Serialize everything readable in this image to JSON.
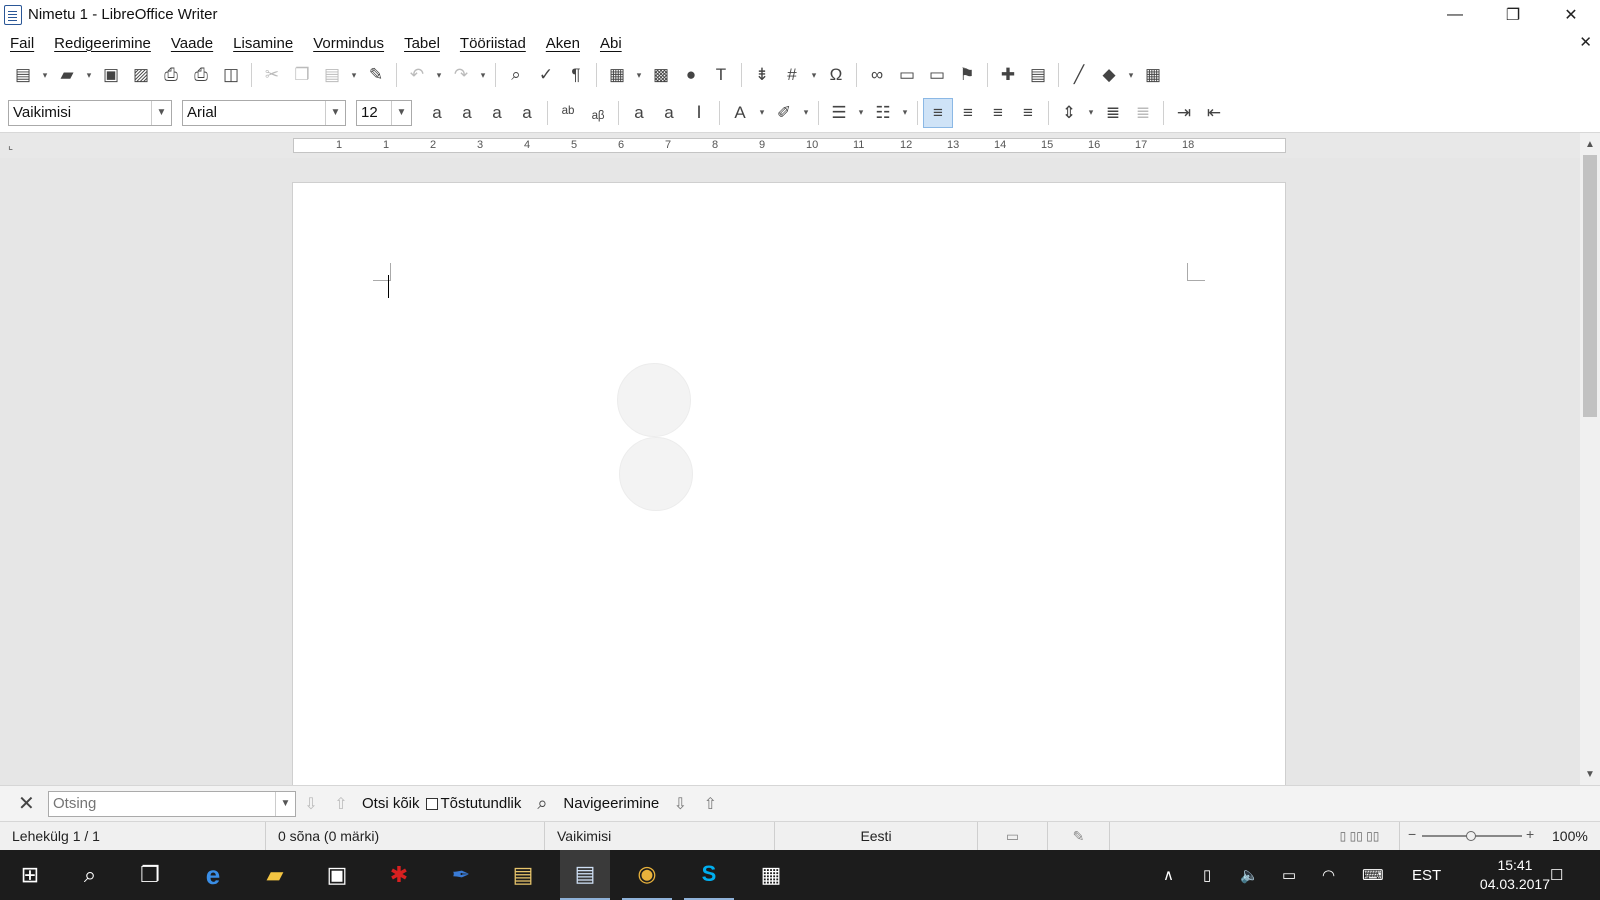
{
  "window": {
    "title": "Nimetu 1 - LibreOffice Writer",
    "minimize_glyph": "—",
    "restore_glyph": "❐",
    "close_glyph": "✕",
    "doc_close_glyph": "✕"
  },
  "menu": [
    "Fail",
    "Redigeerimine",
    "Vaade",
    "Lisamine",
    "Vormindus",
    "Tabel",
    "Tööriistad",
    "Aken",
    "Abi"
  ],
  "standard_toolbar": [
    {
      "name": "new-document-icon",
      "glyph": "▤"
    },
    {
      "name": "new-dropdown-icon",
      "glyph": "▾",
      "small": true
    },
    {
      "name": "open-icon",
      "glyph": "▰"
    },
    {
      "name": "open-dropdown-icon",
      "glyph": "▾",
      "small": true
    },
    {
      "name": "save-icon",
      "glyph": "▣"
    },
    {
      "name": "save-as-icon",
      "glyph": "▨"
    },
    {
      "name": "export-pdf-icon",
      "glyph": "⎙"
    },
    {
      "name": "print-icon",
      "glyph": "⎙"
    },
    {
      "name": "print-preview-icon",
      "glyph": "◫"
    },
    {
      "sep": true
    },
    {
      "name": "cut-icon",
      "glyph": "✂",
      "dim": true
    },
    {
      "name": "copy-icon",
      "glyph": "❐",
      "dim": true
    },
    {
      "name": "paste-icon",
      "glyph": "▤",
      "dim": true
    },
    {
      "name": "paste-dropdown-icon",
      "glyph": "▾",
      "small": true
    },
    {
      "name": "clone-formatting-icon",
      "glyph": "✎"
    },
    {
      "sep": true
    },
    {
      "name": "undo-icon",
      "glyph": "↶",
      "dim": true
    },
    {
      "name": "undo-dropdown-icon",
      "glyph": "▾",
      "small": true
    },
    {
      "name": "redo-icon",
      "glyph": "↷",
      "dim": true
    },
    {
      "name": "redo-dropdown-icon",
      "glyph": "▾",
      "small": true
    },
    {
      "sep": true
    },
    {
      "name": "find-replace-icon",
      "glyph": "⌕"
    },
    {
      "name": "spelling-icon",
      "glyph": "✓"
    },
    {
      "name": "formatting-marks-icon",
      "glyph": "¶"
    },
    {
      "sep": true
    },
    {
      "name": "insert-table-icon",
      "glyph": "▦"
    },
    {
      "name": "table-dropdown-icon",
      "glyph": "▾",
      "small": true
    },
    {
      "name": "insert-image-icon",
      "glyph": "▩"
    },
    {
      "name": "insert-chart-icon",
      "glyph": "●"
    },
    {
      "name": "insert-textbox-icon",
      "glyph": "T"
    },
    {
      "sep": true
    },
    {
      "name": "page-break-icon",
      "glyph": "⇟"
    },
    {
      "name": "insert-field-icon",
      "glyph": "#"
    },
    {
      "name": "field-dropdown-icon",
      "glyph": "▾",
      "small": true
    },
    {
      "name": "special-character-icon",
      "glyph": "Ω"
    },
    {
      "sep": true
    },
    {
      "name": "hyperlink-icon",
      "glyph": "∞"
    },
    {
      "name": "footnote-icon",
      "glyph": "▭"
    },
    {
      "name": "endnote-icon",
      "glyph": "▭"
    },
    {
      "name": "bookmark-icon",
      "glyph": "⚑"
    },
    {
      "sep": true
    },
    {
      "name": "comment-icon",
      "glyph": "✚"
    },
    {
      "name": "track-changes-icon",
      "glyph": "▤"
    },
    {
      "sep": true
    },
    {
      "name": "line-icon",
      "glyph": "╱"
    },
    {
      "name": "basic-shapes-icon",
      "glyph": "◆"
    },
    {
      "name": "shapes-dropdown-icon",
      "glyph": "▾",
      "small": true
    },
    {
      "name": "draw-functions-icon",
      "glyph": "▦"
    }
  ],
  "formatting_toolbar": {
    "paragraph_style": "Vaikimisi",
    "font_name": "Arial",
    "font_size": "12",
    "buttons": [
      {
        "name": "bold-icon",
        "glyph": "a"
      },
      {
        "name": "italic-icon",
        "glyph": "a"
      },
      {
        "name": "underline-icon",
        "glyph": "a"
      },
      {
        "name": "strikethrough-icon",
        "glyph": "a"
      },
      {
        "sep": true
      },
      {
        "name": "superscript-icon",
        "glyph": "ᵃᵇ"
      },
      {
        "name": "subscript-icon",
        "glyph": "ₐᵦ"
      },
      {
        "sep": true
      },
      {
        "name": "shadow-icon",
        "glyph": "a"
      },
      {
        "name": "outline-icon",
        "glyph": "a"
      },
      {
        "name": "clear-formatting-icon",
        "glyph": "Ⅰ"
      },
      {
        "sep": true
      },
      {
        "name": "font-color-icon",
        "glyph": "A"
      },
      {
        "name": "font-color-dropdown-icon",
        "glyph": "▾",
        "small": true
      },
      {
        "name": "highlight-icon",
        "glyph": "✐"
      },
      {
        "name": "highlight-dropdown-icon",
        "glyph": "▾",
        "small": true
      },
      {
        "sep": true
      },
      {
        "name": "bullet-list-icon",
        "glyph": "☰"
      },
      {
        "name": "bullet-dropdown-icon",
        "glyph": "▾",
        "small": true
      },
      {
        "name": "numbered-list-icon",
        "glyph": "☷"
      },
      {
        "name": "numbered-dropdown-icon",
        "glyph": "▾",
        "small": true
      },
      {
        "sep": true
      },
      {
        "name": "align-left-icon",
        "glyph": "≡",
        "active": true
      },
      {
        "name": "align-center-icon",
        "glyph": "≡"
      },
      {
        "name": "align-right-icon",
        "glyph": "≡"
      },
      {
        "name": "justify-icon",
        "glyph": "≡"
      },
      {
        "sep": true
      },
      {
        "name": "line-spacing-icon",
        "glyph": "⇕"
      },
      {
        "name": "line-spacing-dropdown-icon",
        "glyph": "▾",
        "small": true
      },
      {
        "name": "increase-paragraph-spacing-icon",
        "glyph": "≣"
      },
      {
        "name": "decrease-paragraph-spacing-icon",
        "glyph": "≣",
        "dim": true
      },
      {
        "sep": true
      },
      {
        "name": "increase-indent-icon",
        "glyph": "⇥"
      },
      {
        "name": "decrease-indent-icon",
        "glyph": "⇤"
      }
    ]
  },
  "ruler": {
    "corner": "⌞",
    "labels": [
      "1",
      "1",
      "2",
      "3",
      "4",
      "5",
      "6",
      "7",
      "8",
      "9",
      "10",
      "11",
      "12",
      "13",
      "14",
      "15",
      "16",
      "17",
      "18"
    ]
  },
  "find_bar": {
    "close_glyph": "✕",
    "search_placeholder": "Otsing",
    "find_next_glyph": "⇩",
    "find_prev_glyph": "⇧",
    "find_all_label": "Otsi kõik",
    "match_case_label": "Tõstutundlik",
    "find_replace_glyph": "⌕",
    "navigation_label": "Navigeerimine",
    "nav_down_glyph": "⇩",
    "nav_up_glyph": "⇧"
  },
  "status_bar": {
    "page": "Lehekülg 1 / 1",
    "words": "0 sõna (0 märki)",
    "page_style": "Vaikimisi",
    "language": "Eesti",
    "zoom": "100%",
    "zoom_minus": "−",
    "zoom_plus": "+"
  },
  "taskbar": {
    "start_glyph": "⊞",
    "search_glyph": "⌕",
    "task_view_glyph": "❐",
    "edge_glyph": "e",
    "explorer_glyph": "▰",
    "store_glyph": "▣",
    "app1_glyph": "✱",
    "app2_glyph": "✒",
    "app3_glyph": "▤",
    "writer_glyph": "▤",
    "chrome_glyph": "◉",
    "skype_glyph": "S",
    "calculator_glyph": "▦",
    "tray_up_glyph": "∧",
    "tray_file_glyph": "▯",
    "volume_glyph": "🔈",
    "battery_glyph": "▭",
    "wifi_glyph": "◠",
    "keyboard_glyph": "⌨",
    "input_language": "EST",
    "time": "15:41",
    "date": "04.03.2017",
    "notifications_glyph": "☐"
  }
}
